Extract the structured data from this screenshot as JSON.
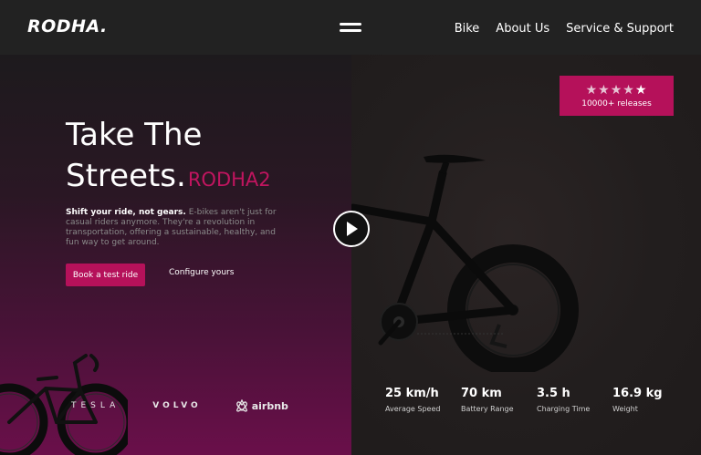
{
  "nav": {
    "logo": "RODHA.",
    "links": [
      "Bike",
      "About Us",
      "Service & Support"
    ]
  },
  "hero": {
    "title_line1": "Take The",
    "title_line2": "Streets.",
    "title_accent": "RODHA2",
    "desc_bold": "Shift your ride, not gears.",
    "desc_rest": " E-bikes aren't just for casual riders anymore. They're a revolution in transportation, offering a sustainable, healthy, and fun way to get around.",
    "cta_primary": "Book a test ride",
    "cta_secondary": "Configure yours"
  },
  "brands": {
    "tesla": "TESLA",
    "volvo": "VOLVO",
    "airbnb": "airbnb"
  },
  "rating": {
    "stars": "★★★★★",
    "stars_value": 5,
    "label": "10000+ releases"
  },
  "stats": [
    {
      "value": "25 km/h",
      "label": "Average Speed"
    },
    {
      "value": "70 km",
      "label": "Battery Range"
    },
    {
      "value": "3.5 h",
      "label": "Charging Time"
    },
    {
      "value": "16.9 kg",
      "label": "Weight"
    }
  ],
  "colors": {
    "accent": "#b5115a",
    "accent_text": "#c0155f",
    "nav_bg": "#222222"
  }
}
